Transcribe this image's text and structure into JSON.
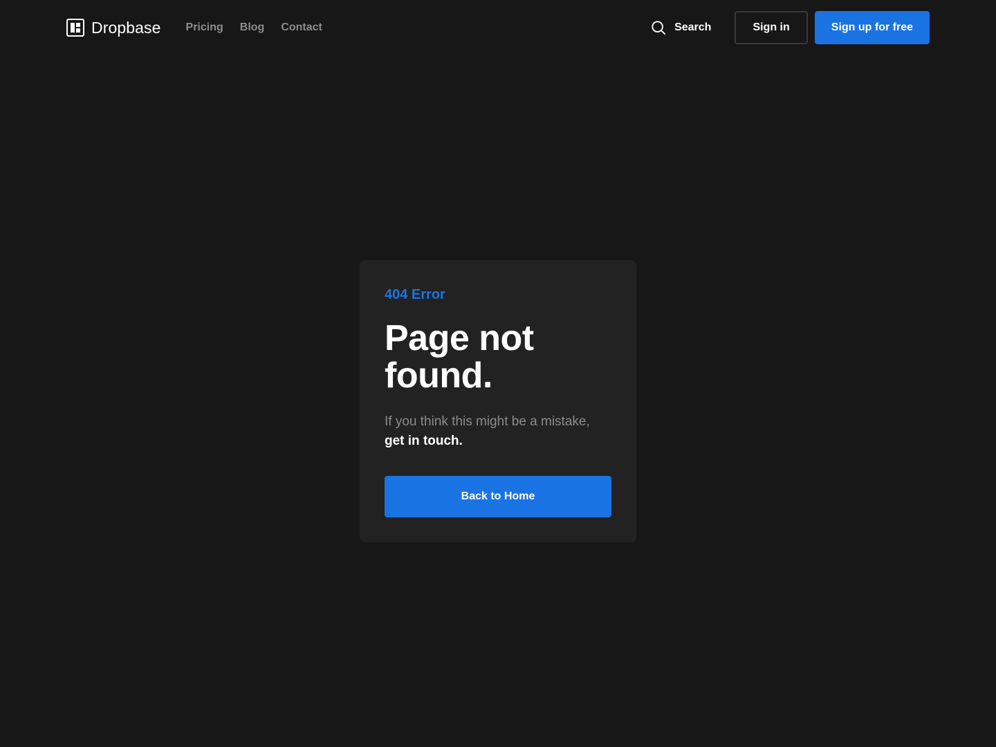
{
  "header": {
    "brand_name": "Dropbase",
    "nav": [
      {
        "label": "Pricing"
      },
      {
        "label": "Blog"
      },
      {
        "label": "Contact"
      }
    ],
    "search_label": "Search",
    "signin_label": "Sign in",
    "signup_label": "Sign up for free"
  },
  "error": {
    "code": "404 Error",
    "title": "Page not found.",
    "description_prefix": "If you think this might be a mistake, ",
    "contact_link": "get in touch.",
    "home_button": "Back to Home"
  },
  "colors": {
    "background": "#171717",
    "card": "#222222",
    "accent": "#1a73e3",
    "muted_text": "#8c8c8c"
  },
  "icons": {
    "brand": "dropbase-logo-icon",
    "search": "search-icon"
  }
}
